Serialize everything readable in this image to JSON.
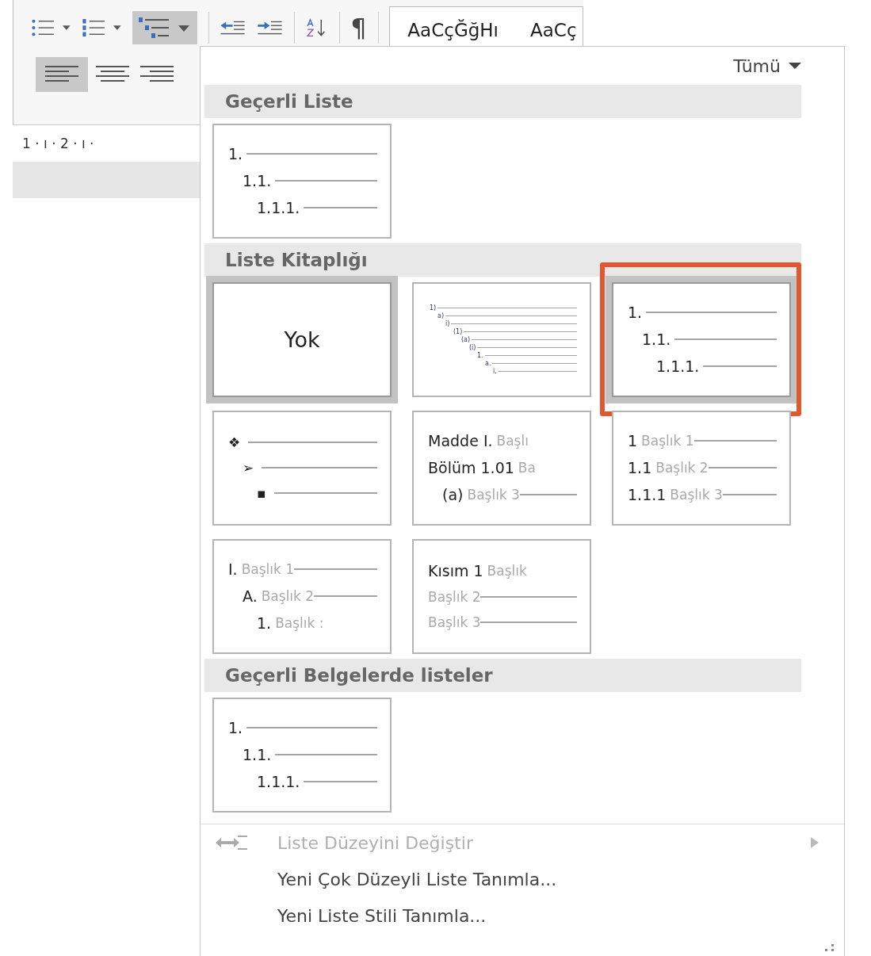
{
  "ribbon": {
    "multilevel_selected": true,
    "align_left_selected": true,
    "pilcrow": "¶",
    "styles": [
      "AaCçĞğHı",
      "AaCç"
    ],
    "ruler": "1 · ı · 2 · ı ·"
  },
  "popup": {
    "filter": "Tümü",
    "sections": [
      {
        "title": "Geçerli Liste",
        "items": [
          {
            "kind": "levels",
            "selected": false,
            "annotated": false,
            "lines": [
              {
                "number": "1.",
                "rule": true,
                "children": [
                  {
                    "number": "1.1.",
                    "rule": true,
                    "children": [
                      {
                        "number": "1.1.1.",
                        "rule": true
                      }
                    ]
                  }
                ]
              }
            ]
          }
        ]
      },
      {
        "title": "Liste Kitaplığı",
        "items": [
          {
            "kind": "none",
            "selected": true,
            "annotated": false,
            "label": "Yok"
          },
          {
            "kind": "small",
            "selected": false,
            "annotated": false,
            "lines": [
              {
                "number": "1)",
                "rule": true,
                "children": [
                  {
                    "number": "a)",
                    "rule": true,
                    "children": [
                      {
                        "number": "i)",
                        "rule": true,
                        "children": [
                          {
                            "number": "(1)",
                            "rule": true,
                            "children": [
                              {
                                "number": "(a)",
                                "rule": true,
                                "children": [
                                  {
                                    "number": "(i)",
                                    "rule": true,
                                    "children": [
                                      {
                                        "number": "1.",
                                        "rule": true,
                                        "children": [
                                          {
                                            "number": "a.",
                                            "rule": true,
                                            "children": [
                                              {
                                                "number": "i.",
                                                "rule": true
                                              }
                                            ]
                                          }
                                        ]
                                      }
                                    ]
                                  }
                                ]
                              }
                            ]
                          }
                        ]
                      }
                    ]
                  }
                ]
              }
            ]
          },
          {
            "kind": "levels",
            "selected": true,
            "annotated": true,
            "lines": [
              {
                "number": "1.",
                "rule": true,
                "children": [
                  {
                    "number": "1.1.",
                    "rule": true,
                    "children": [
                      {
                        "number": "1.1.1.",
                        "rule": true
                      }
                    ]
                  }
                ]
              }
            ]
          },
          {
            "kind": "bullets",
            "selected": false,
            "annotated": false,
            "lines": [
              {
                "number": "❖",
                "rule": true,
                "children": [
                  {
                    "number": "➢",
                    "rule": true,
                    "children": [
                      {
                        "number": "▪",
                        "rule": true
                      }
                    ]
                  }
                ]
              }
            ]
          },
          {
            "kind": "levels",
            "selected": false,
            "annotated": false,
            "lines": [
              {
                "number": "Madde I.",
                "heading": "Başlı",
                "rule": false
              },
              {
                "number": "Bölüm 1.01",
                "heading": "Ba",
                "rule": false,
                "children": [
                  {
                    "number": "(a)",
                    "heading": "Başlık 3",
                    "rule": true
                  }
                ]
              }
            ]
          },
          {
            "kind": "levels",
            "selected": false,
            "annotated": false,
            "lines": [
              {
                "number": "1",
                "heading": "Başlık 1",
                "rule": true
              },
              {
                "number": "1.1",
                "heading": "Başlık 2",
                "rule": true
              },
              {
                "number": "1.1.1",
                "heading": "Başlık 3",
                "rule": true
              }
            ]
          },
          {
            "kind": "levels",
            "selected": false,
            "annotated": false,
            "lines": [
              {
                "number": "I.",
                "heading": "Başlık 1",
                "rule": true,
                "children": [
                  {
                    "number": "A.",
                    "heading": "Başlık 2",
                    "rule": true,
                    "children": [
                      {
                        "number": "1.",
                        "heading": "Başlık :",
                        "rule": false
                      }
                    ]
                  }
                ]
              }
            ]
          },
          {
            "kind": "levels",
            "selected": false,
            "annotated": false,
            "lines": [
              {
                "number": "Kısım 1",
                "heading": "Başlık",
                "rule": false
              },
              {
                "heading": "Başlık 2",
                "rule": true
              },
              {
                "heading": "Başlık 3",
                "rule": true
              }
            ]
          }
        ]
      },
      {
        "title": "Geçerli Belgelerde listeler",
        "items": [
          {
            "kind": "levels",
            "selected": false,
            "annotated": false,
            "lines": [
              {
                "number": "1.",
                "rule": true,
                "children": [
                  {
                    "number": "1.1.",
                    "rule": true,
                    "children": [
                      {
                        "number": "1.1.1.",
                        "rule": true
                      }
                    ]
                  }
                ]
              }
            ]
          }
        ]
      }
    ],
    "menu": [
      {
        "label": "Liste Düzeyini Değiştir",
        "disabled": true,
        "submenu": true
      },
      {
        "label": "Yeni Çok Düzeyli Liste Tanımla...",
        "disabled": false,
        "submenu": false
      },
      {
        "label": "Yeni Liste Stili Tanımla...",
        "disabled": false,
        "submenu": false
      }
    ]
  }
}
